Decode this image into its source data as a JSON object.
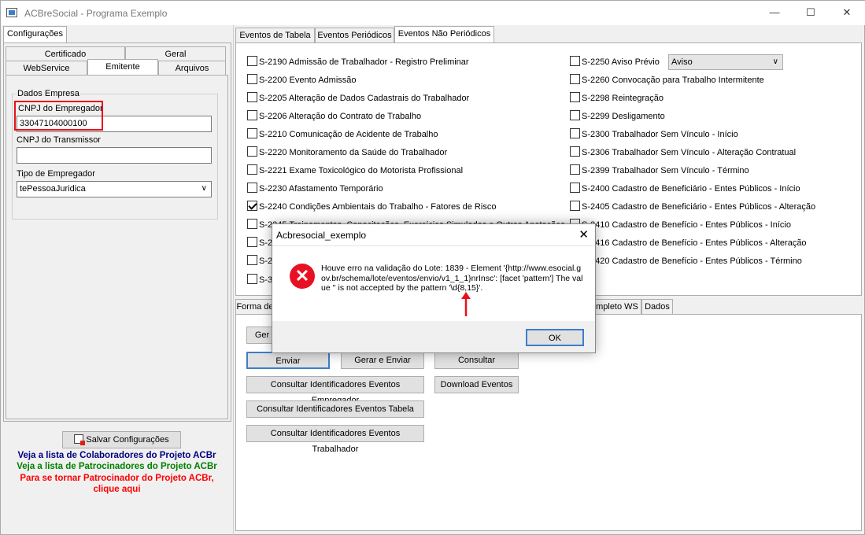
{
  "window": {
    "title": "ACBreSocial - Programa Exemplo",
    "min": "—",
    "max": "☐",
    "close": "✕"
  },
  "left": {
    "tab_config": "Configurações",
    "subtabs": {
      "certificado": "Certificado",
      "geral": "Geral",
      "webservice": "WebService",
      "emitente": "Emitente",
      "arquivos": "Arquivos"
    },
    "group": "Dados Empresa",
    "cnpj_empregador_label": "CNPJ do Empregador",
    "cnpj_empregador_value": "33047104000100",
    "cnpj_transmissor_label": "CNPJ do Transmissor",
    "cnpj_transmissor_value": "",
    "tipo_label": "Tipo de Empregador",
    "tipo_value": "tePessoaJuridica",
    "save_button": "Salvar Configurações",
    "links": {
      "colaboradores": "Veja a lista de Colaboradores do Projeto ACBr",
      "patrocinadores": "Veja a lista de Patrocinadores do Projeto ACBr",
      "patrocinar_1": "Para se tornar Patrocinador do Projeto ACBr,",
      "patrocinar_2": "clique aqui"
    }
  },
  "right": {
    "tabs": {
      "tabela": "Eventos de Tabela",
      "periodicos": "Eventos Periódicos",
      "nao_periodicos": "Eventos Não Periódicos"
    },
    "events_left": [
      {
        "label": "S-2190 Admissão de Trabalhador - Registro Preliminar",
        "checked": false
      },
      {
        "label": "S-2200 Evento Admissão",
        "checked": false
      },
      {
        "label": "S-2205 Alteração de Dados Cadastrais do Trabalhador",
        "checked": false
      },
      {
        "label": "S-2206 Alteração do Contrato de Trabalho",
        "checked": false
      },
      {
        "label": "S-2210 Comunicação de Acidente de Trabalho",
        "checked": false
      },
      {
        "label": "S-2220 Monitoramento da Saúde do Trabalhador",
        "checked": false
      },
      {
        "label": "S-2221 Exame Toxicológico do Motorista Profissional",
        "checked": false
      },
      {
        "label": "S-2230 Afastamento Temporário",
        "checked": false
      },
      {
        "label": "S-2240 Condições Ambientais do Trabalho - Fatores de Risco",
        "checked": true
      },
      {
        "label": "S-2245 Treinamentos, Capacitações, Exercícios Simulados e Outras Anotações",
        "checked": false
      },
      {
        "label": "S-2",
        "checked": false
      },
      {
        "label": "S-2",
        "checked": false
      },
      {
        "label": "S-3",
        "checked": false
      }
    ],
    "events_right": [
      {
        "label": "S-2250 Aviso Prévio",
        "checked": false
      },
      {
        "label": "S-2260 Convocação para Trabalho Intermitente",
        "checked": false
      },
      {
        "label": "S-2298 Reintegração",
        "checked": false
      },
      {
        "label": "S-2299 Desligamento",
        "checked": false
      },
      {
        "label": "S-2300 Trabalhador Sem Vínculo - Início",
        "checked": false
      },
      {
        "label": "S-2306 Trabalhador Sem Vínculo - Alteração Contratual",
        "checked": false
      },
      {
        "label": "S-2399 Trabalhador Sem Vínculo - Término",
        "checked": false
      },
      {
        "label": "S-2400 Cadastro de Beneficiário - Entes Públicos - Início",
        "checked": false
      },
      {
        "label": "S-2405 Cadastro de Beneficiário - Entes Públicos - Alteração",
        "checked": false
      },
      {
        "label": "S-2410 Cadastro de Benefício - Entes Públicos - Início",
        "checked": false
      },
      {
        "label": "S-2416 Cadastro de Benefício - Entes Públicos - Alteração",
        "checked": false
      },
      {
        "label": "S-2420 Cadastro de Benefício - Entes Públicos - Término",
        "checked": false
      }
    ],
    "aviso_select": "Aviso",
    "bottom_tabs": {
      "forma": "Forma de",
      "completo": "mpleto WS",
      "dados": "Dados"
    },
    "buttons": {
      "gerar": "Ger",
      "enviar": "Enviar",
      "gerar_enviar": "Gerar e Enviar",
      "consultar": "Consultar",
      "cons_ident_empregador": "Consultar Identificadores Eventos Empregador",
      "download": "Download Eventos",
      "cons_ident_tabela": "Consultar Identificadores Eventos Tabela",
      "cons_ident_trabalhador": "Consultar Identificadores Eventos Trabalhador"
    }
  },
  "dialog": {
    "title": "Acbresocial_exemplo",
    "message": "Houve erro na validação do Lote: 1839 - Element '{http://www.esocial.gov.br/schema/lote/eventos/envio/v1_1_1}nrInsc': [facet 'pattern'] The value '' is not accepted by the pattern '\\d{8,15}'.",
    "ok": "OK"
  },
  "colors": {
    "highlight": "#e8101a",
    "link_blue": "#000080",
    "link_green": "#008000",
    "link_red": "#ff0000"
  }
}
